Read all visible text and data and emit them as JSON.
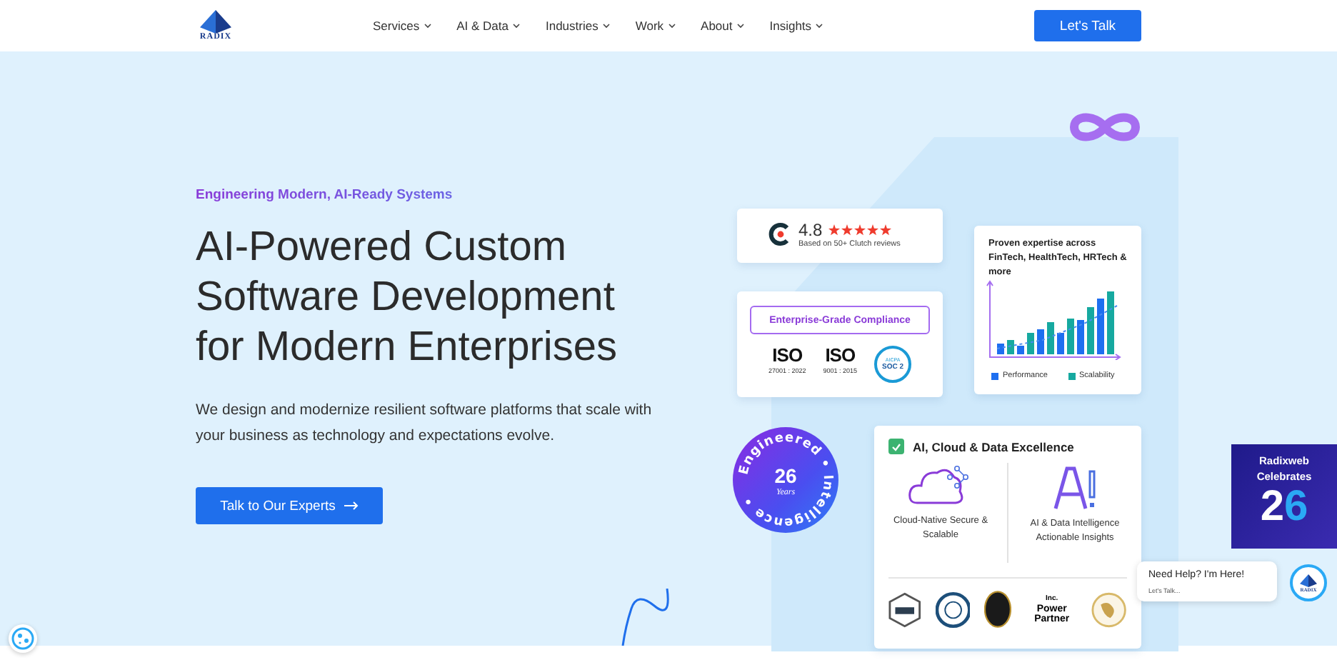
{
  "header": {
    "logo_text": "RADIX",
    "nav": [
      {
        "label": "Services"
      },
      {
        "label": "AI & Data"
      },
      {
        "label": "Industries"
      },
      {
        "label": "Work"
      },
      {
        "label": "About"
      },
      {
        "label": "Insights"
      }
    ],
    "cta": "Let's Talk"
  },
  "hero": {
    "eyebrow": "Engineering Modern, AI-Ready Systems",
    "title": [
      "AI-Powered Custom",
      "Software Development",
      "for Modern Enterprises"
    ],
    "description": "We design and modernize resilient software platforms that scale with your business as technology and expectations evolve.",
    "cta": "Talk to Our Experts"
  },
  "rating_card": {
    "score": "4.8",
    "stars": 5,
    "caption": "Based on 50+ Clutch reviews"
  },
  "compliance_card": {
    "title": "Enterprise-Grade Compliance",
    "certs": [
      {
        "kind": "iso",
        "name": "ISO",
        "code": "27001 : 2022"
      },
      {
        "kind": "iso",
        "name": "ISO",
        "code": "9001 : 2015"
      },
      {
        "kind": "soc",
        "name": "AICPA",
        "code": "SOC 2"
      }
    ]
  },
  "chart_card": {
    "title": "Proven expertise across FinTech, HealthTech, HRTech & more",
    "legend": [
      {
        "label": "Performance",
        "color": "#1e6ff0"
      },
      {
        "label": "Scalability",
        "color": "#16a9a0"
      }
    ]
  },
  "years_badge": {
    "ring_text": "Engineered • Intelligence •",
    "number": "26",
    "unit": "Years"
  },
  "excellence_card": {
    "title": "AI, Cloud & Data Excellence",
    "checked": true,
    "features": [
      {
        "kind": "cloud",
        "label": "Cloud-Native Secure & Scalable"
      },
      {
        "kind": "ai",
        "label": "AI & Data Intelligence Actionable Insights"
      }
    ],
    "awards": [
      {
        "kind": "clutch"
      },
      {
        "kind": "seal"
      },
      {
        "kind": "medal"
      },
      {
        "kind": "power",
        "label": "Power Partner",
        "brand": "Inc."
      },
      {
        "kind": "globe"
      }
    ]
  },
  "promo": {
    "title": "Radixweb Celebrates",
    "number": "26"
  },
  "chat": {
    "title": "Need Help? I'm Here!",
    "subtitle": "Let's Talk...",
    "logo_text": "RADIX"
  }
}
